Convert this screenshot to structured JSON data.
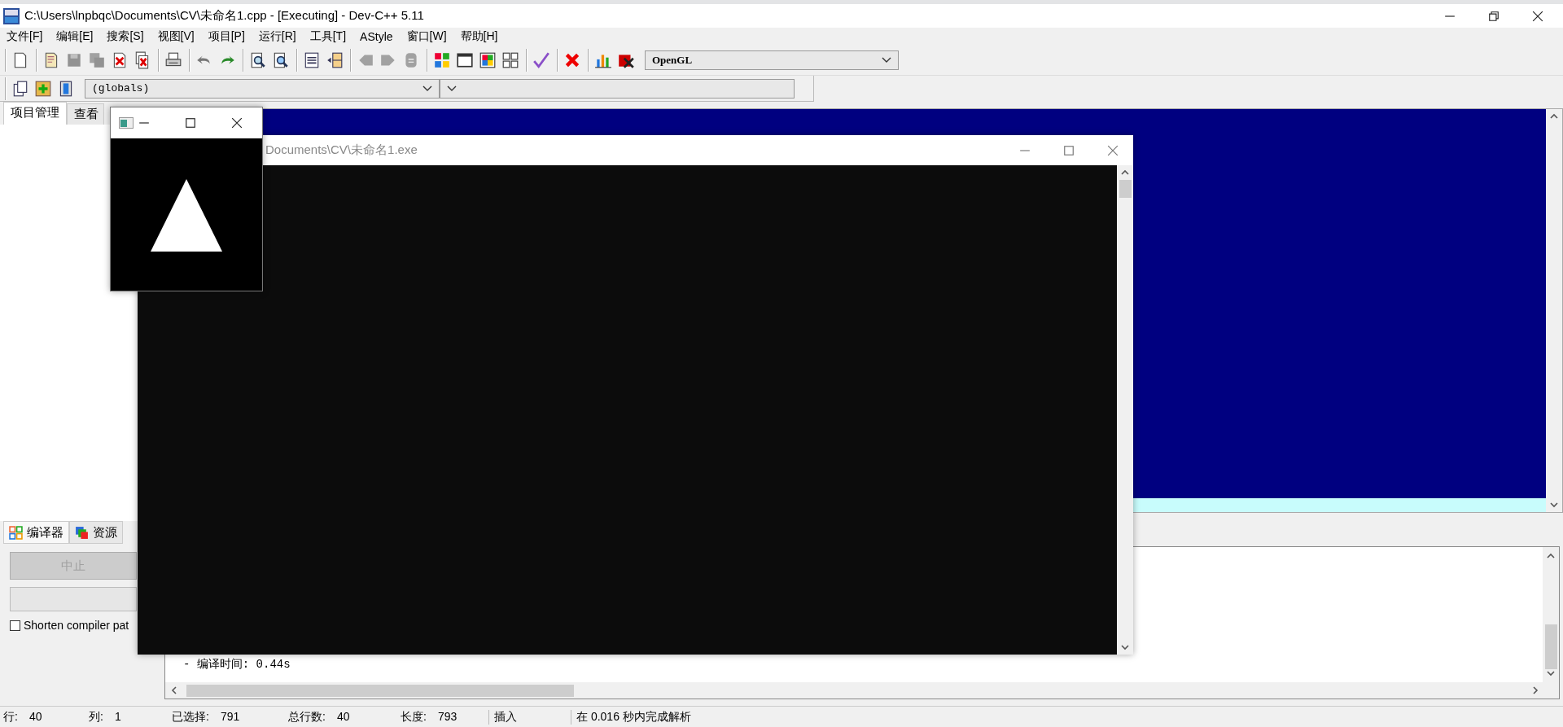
{
  "window": {
    "title": "C:\\Users\\lnpbqc\\Documents\\CV\\未命名1.cpp - [Executing] - Dev-C++ 5.11"
  },
  "menu": [
    "文件[F]",
    "编辑[E]",
    "搜索[S]",
    "视图[V]",
    "项目[P]",
    "运行[R]",
    "工具[T]",
    "AStyle",
    "窗口[W]",
    "帮助[H]"
  ],
  "toolbar": {
    "compiler": "OpenGL"
  },
  "class_bar": {
    "scope": "(globals)"
  },
  "left_panel": {
    "tabs": [
      {
        "label": "项目管理",
        "selected": true
      },
      {
        "label": "查看",
        "selected": false
      }
    ]
  },
  "bottom_panel": {
    "tabs": [
      {
        "label": "编译器",
        "selected": true
      },
      {
        "label": "资源",
        "selected": false
      }
    ],
    "abort_button": {
      "label": "中止",
      "disabled": true
    },
    "progress": {
      "level": 0
    },
    "shorten_paths": {
      "label": "Shorten compiler pat",
      "checked": false
    },
    "output": [
      "- 编译时间: 0.44s"
    ]
  },
  "status_bar": {
    "fields": [
      {
        "label": "行:",
        "value": "40"
      },
      {
        "label": "列:",
        "value": "1"
      },
      {
        "label": "已选择:",
        "value": "791"
      },
      {
        "label": "总行数:",
        "value": "40"
      },
      {
        "label": "长度:",
        "value": "793"
      }
    ],
    "mode": "插入",
    "message": "在 0.016 秒内完成解析"
  },
  "console_window": {
    "title": "Documents\\CV\\未命名1.exe"
  }
}
